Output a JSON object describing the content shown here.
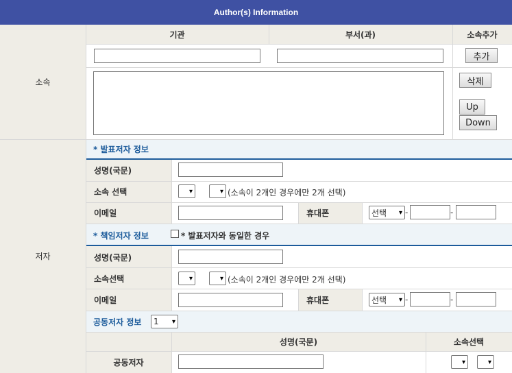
{
  "header": {
    "title": "Author(s) Information"
  },
  "affiliation": {
    "row_label": "소속",
    "col_org": "기관",
    "col_dept": "부서(과)",
    "col_add": "소속추가",
    "add_button": "추가",
    "delete_button": "삭제",
    "up_button": "Up",
    "down_button": "Down"
  },
  "authors": {
    "row_label": "저자",
    "presenter": {
      "title": "* 발표저자 정보",
      "name_label": "성명(국문)",
      "affil_label": "소속 선택",
      "affil_hint": "(소속이 2개인 경우에만 2개 선택)",
      "email_label": "이메일",
      "phone_label": "휴대폰",
      "phone_select": "선택",
      "dash": "-"
    },
    "corresponding": {
      "title": "* 책임저자 정보",
      "same_as_label": "* 발표저자와 동일한 경우",
      "name_label": "성명(국문)",
      "affil_label": "소속선택",
      "affil_hint": "(소속이 2개인 경우에만 2개 선택)",
      "email_label": "이메일",
      "phone_label": "휴대폰",
      "phone_select": "선택",
      "dash": "-"
    },
    "coauthors": {
      "title": "공동저자 정보",
      "count_select": "1",
      "col_name": "성명(국문)",
      "col_affil": "소속선택",
      "row_label": "공동저자"
    }
  }
}
